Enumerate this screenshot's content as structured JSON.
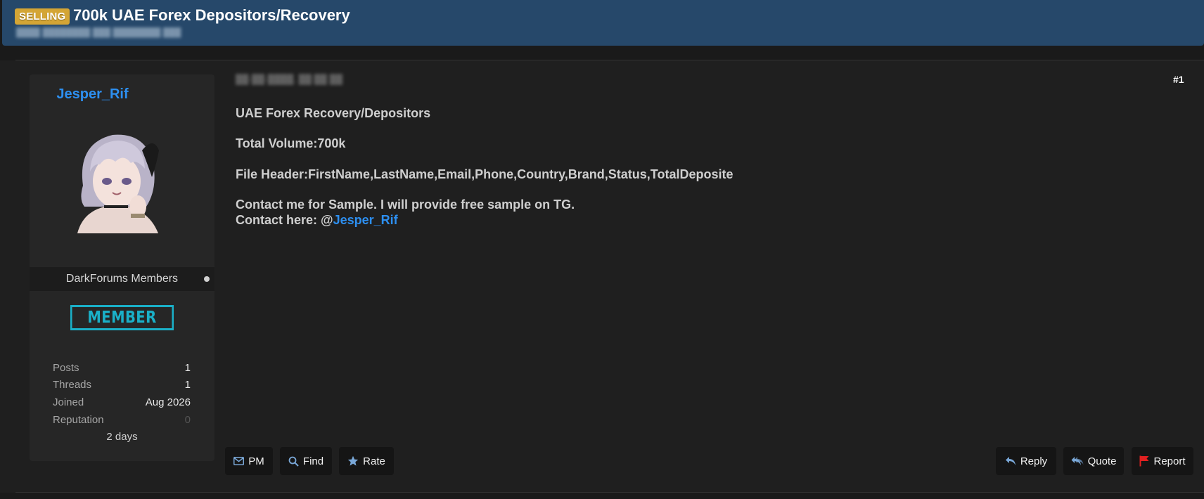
{
  "thread": {
    "badge": "SELLING",
    "title": "700k UAE Forex Depositors/Recovery"
  },
  "author": {
    "username": "Jesper_Rif",
    "group": "DarkForums Members",
    "rank": "MEMBER",
    "stats": [
      {
        "label": "Posts",
        "value": "1"
      },
      {
        "label": "Threads",
        "value": "1"
      },
      {
        "label": "Joined",
        "value": "Aug 2026"
      },
      {
        "label": "Reputation",
        "value": "0"
      }
    ],
    "active": "2 days"
  },
  "post": {
    "number": "#1",
    "lines": [
      "UAE Forex Recovery/Depositors",
      "Total Volume:700k",
      "File Header:FirstName,LastName,Email,Phone,Country,Brand,Status,TotalDeposite",
      "Contact me for Sample. I will provide free sample on TG."
    ],
    "contact_prefix": "Contact here: @",
    "contact_handle": "Jesper_Rif"
  },
  "actions": {
    "pm": "PM",
    "find": "Find",
    "rate": "Rate",
    "reply": "Reply",
    "quote": "Quote",
    "report": "Report"
  },
  "colors": {
    "header": "#26486a",
    "badge": "#d4a535",
    "link": "#2d8ff0",
    "rank": "#1ab0c8",
    "report_flag": "#e02020"
  },
  "icons": {
    "pm": "envelope-icon",
    "find": "magnifier-icon",
    "rate": "star-icon",
    "reply": "reply-arrow-icon",
    "quote": "quote-arrows-icon",
    "report": "flag-icon"
  }
}
